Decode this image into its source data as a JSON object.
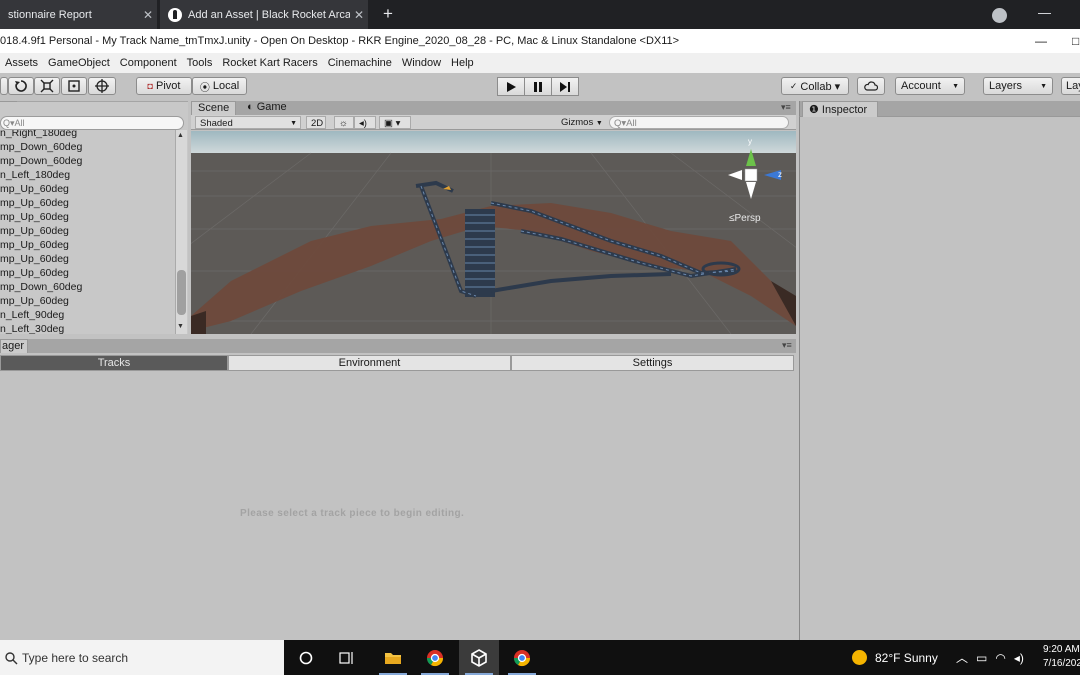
{
  "browser": {
    "tabs": [
      {
        "label": "stionnaire Report",
        "close": "✕"
      },
      {
        "label": "Add an Asset | Black Rocket Arca",
        "close": "✕"
      }
    ],
    "new_tab": "+"
  },
  "window": {
    "title": "018.4.9f1 Personal - My Track Name_tmTmxJ.unity - Open On Desktop - RKR Engine_2020_08_28 - PC, Mac & Linux Standalone <DX11>",
    "minimize": "—",
    "maximize": "□"
  },
  "menu": [
    "Assets",
    "GameObject",
    "Component",
    "Tools",
    "Rocket Kart Racers",
    "Cinemachine",
    "Window",
    "Help"
  ],
  "toolbar": {
    "pivot": "Pivot",
    "local": "Local",
    "collab": "Collab ▾",
    "account": "Account",
    "layers": "Layers",
    "layout": "Lay"
  },
  "hierarchy": {
    "tab_label": "ny",
    "search_placeholder": "Q▾All",
    "items": [
      "n_Right_180deg",
      "mp_Down_60deg",
      "mp_Down_60deg",
      "n_Left_180deg",
      "mp_Up_60deg",
      "mp_Up_60deg",
      "mp_Up_60deg",
      "mp_Up_60deg",
      "mp_Up_60deg",
      "mp_Up_60deg",
      "mp_Up_60deg",
      "mp_Down_60deg",
      "mp_Up_60deg",
      "n_Left_90deg",
      "n_Left_30deg"
    ]
  },
  "scene": {
    "tabs": [
      "Scene",
      "Game"
    ],
    "shading": "Shaded",
    "mode_2d": "2D",
    "gizmos": "Gizmos",
    "search_placeholder": "Q▾All",
    "persp_label": "≤Persp",
    "axis_y": "y",
    "axis_z": "z"
  },
  "inspector": {
    "tab_label": "Inspector"
  },
  "track_manager": {
    "panel_label": "ager",
    "tabs": [
      "Tracks",
      "Environment",
      "Settings"
    ],
    "hint": "Please select a track piece to begin editing."
  },
  "taskbar": {
    "search_placeholder": "Type here to search",
    "weather": "82°F  Sunny",
    "time": "9:20 AM",
    "date": "7/16/202"
  },
  "colors": {
    "accent_active_tab": "#5a5a5a",
    "sky": "#b4c8cf",
    "ground": "#5d5a57",
    "terrain": "#6e4a3c",
    "track": "#2d3a4c"
  }
}
